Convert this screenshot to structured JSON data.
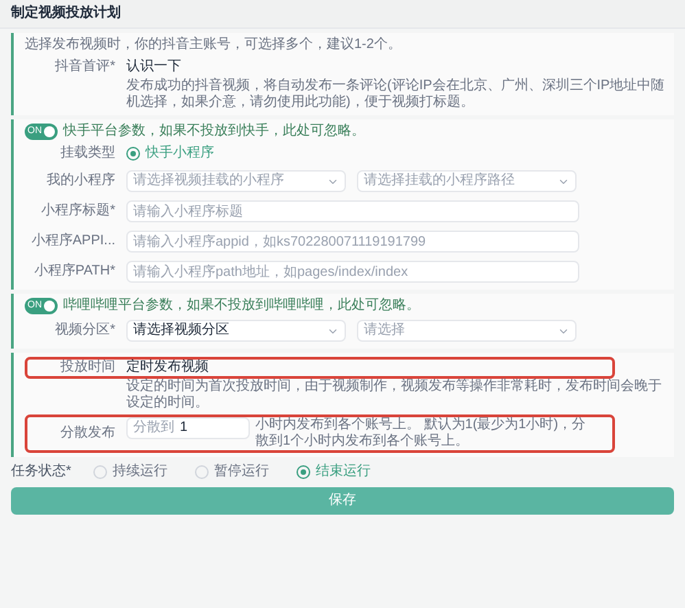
{
  "title": "制定视频投放计划",
  "sections": [
    {
      "hint": "选择发布视频时，你的抖音主账号，可选择多个，建议1-2个。",
      "fields": [
        {
          "kind": "text",
          "label": "抖音首评*",
          "value": "认识一下",
          "note": "发布成功的抖音视频，将自动发布一条评论(评论IP会在北京、广州、深圳三个IP地址中随机选择，如果介意，请勿使用此功能)，便于视频打标题。"
        }
      ]
    },
    {
      "toggle": {
        "on": true,
        "label": "ON",
        "text": "快手平台参数，如果不投放到快手，此处可忽略。"
      },
      "fields": [
        {
          "kind": "radio",
          "label": "挂载类型",
          "options": [
            {
              "label": "快手小程序",
              "selected": true
            }
          ]
        },
        {
          "kind": "selects",
          "label": "我的小程序",
          "selects": [
            {
              "placeholder": "请选择视频挂载的小程序"
            },
            {
              "placeholder": "请选择挂载的小程序路径"
            }
          ]
        },
        {
          "kind": "input",
          "label": "小程序标题*",
          "placeholder": "请输入小程序标题"
        },
        {
          "kind": "input",
          "label": "小程序APPI...",
          "placeholder": "请输入小程序appid，如ks702280071119191799"
        },
        {
          "kind": "input",
          "label": "小程序PATH*",
          "placeholder": "请输入小程序path地址，如pages/index/index"
        }
      ]
    },
    {
      "toggle": {
        "on": true,
        "label": "ON",
        "text": "哔哩哔哩平台参数，如果不投放到哔哩哔哩，此处可忽略。"
      },
      "fields": [
        {
          "kind": "selects",
          "label": "视频分区*",
          "selects": [
            {
              "value": "请选择视频分区"
            },
            {
              "placeholder": "请选择"
            }
          ]
        }
      ]
    },
    {
      "fields": [
        {
          "kind": "text",
          "label": "投放时间",
          "value": "定时发布视频",
          "highlighted": true,
          "note": "设定的时间为首次投放时间，由于视频制作，视频发布等操作非常耗时，发布时间会晚于设定的时间。"
        },
        {
          "kind": "split",
          "label": "分散发布",
          "prefix": "分散到",
          "value": "1",
          "suffix": "小时内发布到各个账号上。 默认为1(最少为1小时)，分散到1个小时内发布到各个账号上。",
          "highlighted": true
        }
      ]
    }
  ],
  "status": {
    "label": "任务状态*",
    "options": [
      {
        "label": "持续运行",
        "selected": false
      },
      {
        "label": "暂停运行",
        "selected": false
      },
      {
        "label": "结束运行",
        "selected": true
      }
    ]
  },
  "save": "保存"
}
